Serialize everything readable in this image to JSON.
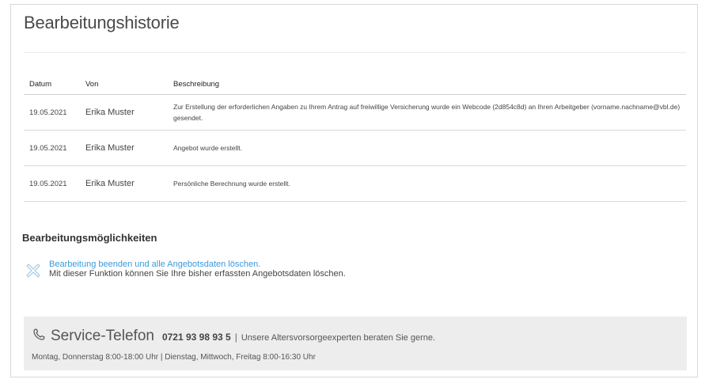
{
  "page": {
    "title": "Bearbeitungshistorie"
  },
  "history": {
    "headers": {
      "date": "Datum",
      "von": "Von",
      "desc": "Beschreibung"
    },
    "rows": [
      {
        "date": "19.05.2021",
        "von": "Erika Muster",
        "desc": "Zur Erstellung der erforderlichen Angaben zu Ihrem Antrag auf freiwillige Versicherung wurde ein Webcode (2d854c8d) an Ihren Arbeitgeber (vorname.nachname@vbl.de) gesendet."
      },
      {
        "date": "19.05.2021",
        "von": "Erika Muster",
        "desc": "Angebot wurde erstellt."
      },
      {
        "date": "19.05.2021",
        "von": "Erika Muster",
        "desc": "Persönliche Berechnung wurde erstellt."
      }
    ]
  },
  "options": {
    "heading": "Bearbeitungsmöglichkeiten",
    "action_link": "Bearbeitung beenden und alle Angebotsdaten löschen.",
    "action_desc": "Mit dieser Funktion können Sie Ihre bisher erfassten Angebotsdaten löschen.",
    "icon": "close-x-icon"
  },
  "service": {
    "icon": "phone-icon",
    "title": "Service-Telefon",
    "number": "0721 93 98 93 5",
    "separator": "|",
    "tagline": "Unsere Altersvorsorgeexperten beraten Sie gerne.",
    "hours": "Montag, Donnerstag 8:00-18:00 Uhr | Dienstag, Mittwoch, Freitag 8:00-16:30 Uhr"
  },
  "colors": {
    "link": "#3a9ad9",
    "service_bg": "#ededed",
    "icon_outline": "#9cc9e6"
  }
}
